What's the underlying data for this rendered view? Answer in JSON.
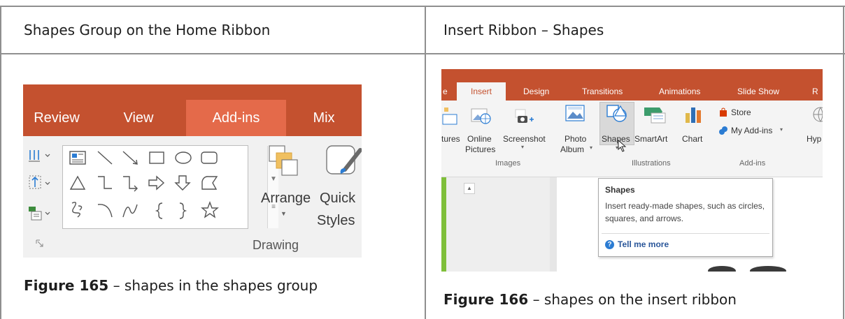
{
  "table": {
    "left_header": "Shapes Group on the Home Ribbon",
    "right_header": "Insert Ribbon – Shapes"
  },
  "figure165": {
    "caption_bold": "Figure 165",
    "caption_text": " – shapes in the shapes group",
    "tabs": [
      "Review",
      "View",
      "Add-ins",
      "Mix"
    ],
    "active_tab": "Add-ins",
    "arrange_label": "Arrange",
    "quick_styles_line1": "Quick",
    "quick_styles_line2": "Styles",
    "group_label": "Drawing",
    "shape_rows": [
      [
        "text-box",
        "line",
        "arrow-line",
        "rectangle",
        "oval",
        "rounded-rectangle"
      ],
      [
        "triangle",
        "elbow-connector",
        "elbow-arrow-connector",
        "right-arrow",
        "down-arrow",
        "freeform-shape"
      ],
      [
        "scribble",
        "arc",
        "curve",
        "left-brace",
        "right-brace",
        "star"
      ]
    ],
    "colors": {
      "ribbon": "#c4512f",
      "active_tab": "#e46a4a"
    }
  },
  "figure166": {
    "caption_bold": "Figure 166",
    "caption_text": " – shapes on the insert ribbon",
    "tabs": [
      "Insert",
      "Design",
      "Transitions",
      "Animations",
      "Slide Show",
      "R"
    ],
    "active_tab": "Insert",
    "buttons": {
      "tures": "tures",
      "online_pictures_1": "Online",
      "online_pictures_2": "Pictures",
      "screenshot": "Screenshot",
      "photo_album_1": "Photo",
      "photo_album_2": "Album",
      "shapes": "Shapes",
      "smartart": "SmartArt",
      "chart": "Chart",
      "store": "Store",
      "my_addins": "My Add-ins",
      "hyp": "Hyp"
    },
    "groups": {
      "images": "Images",
      "illustrations": "Illustrations",
      "addins": "Add-ins"
    },
    "tooltip": {
      "title": "Shapes",
      "body": "Insert ready-made shapes, such as circles, squares, and arrows.",
      "help": "Tell me more"
    },
    "colors": {
      "ribbon": "#c4512f",
      "thumbnail_strip": "#7fbf3a",
      "help_link": "#2b579a"
    }
  }
}
